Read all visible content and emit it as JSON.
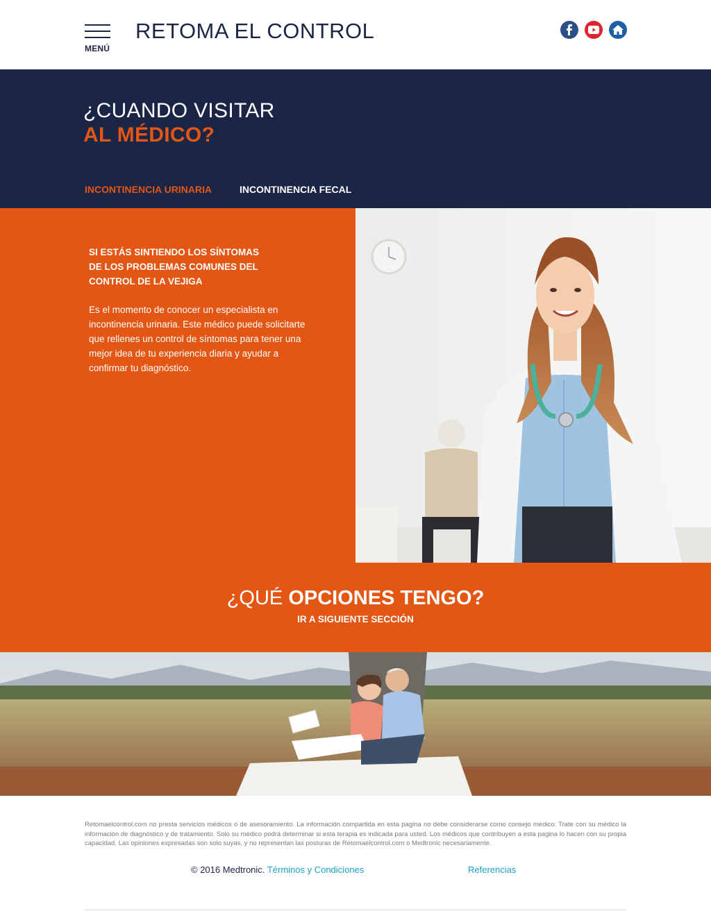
{
  "header": {
    "menu_label": "MENÚ",
    "site_title": "RETOMA EL CONTROL",
    "social_icons": [
      "facebook-icon",
      "youtube-icon",
      "home-icon"
    ]
  },
  "hero": {
    "title_line1": "¿CUANDO VISITAR",
    "title_line2": "AL MÉDICO?",
    "tabs": [
      {
        "label": "INCONTINENCIA URINARIA",
        "active": true
      },
      {
        "label": "INCONTINENCIA FECAL",
        "active": false
      }
    ]
  },
  "content": {
    "heading_lines": [
      "SI ESTÁS SINTIENDO LOS SÍNTOMAS",
      "DE LOS PROBLEMAS COMUNES DEL",
      "CONTROL DE LA VEJIGA"
    ],
    "body": "Es el momento de conocer un especialista en incontinencia urinaria. Este médico puede solicitarte que rellenes un control de síntomas para tener una mejor idea de tu experiencia diaria y ayudar a confirmar tu diagnóstico."
  },
  "cta": {
    "title_light": "¿QUÉ",
    "title_bold": "OPCIONES TENGO?",
    "link": "IR A SIGUIENTE SECCIÓN"
  },
  "footer": {
    "disclaimer": "Retomaelcontrol.com no presta servicios médicos o de asesoramiento. La información compartida en esta pagina no debe considerarse como consejo médico. Trate con su médico la información de diagnóstico y de tratamiento. Solo su médico podrá determinar si esta terapia es indicada para usted. Los médicos que contribuyen a esta pagina lo hacen con su propia capacidad. Las opiniones expresadas son solo suyas, y no representan las posturas de Retomaelcontrol.com o Medtronic necesariamente.",
    "copyright": "© 2016 Medtronic.",
    "terms_link": "Términos y Condiciones",
    "references_link": "Referencias"
  },
  "colors": {
    "navy": "#1b2545",
    "orange": "#e35614",
    "link": "#1aa3c5"
  }
}
